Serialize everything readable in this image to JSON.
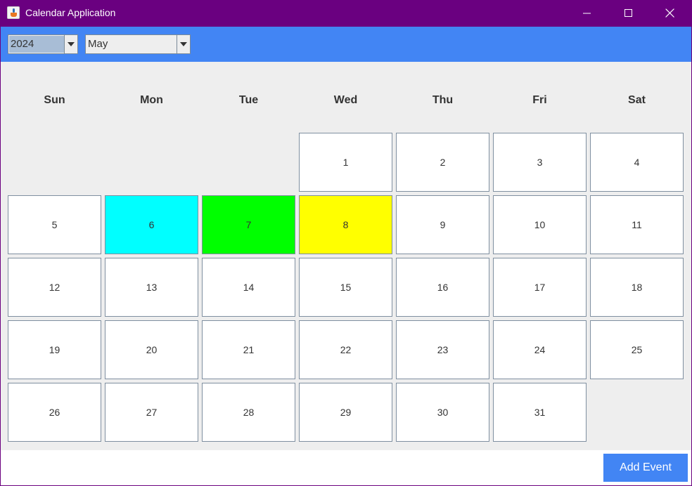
{
  "window": {
    "title": "Calendar Application",
    "icon": "java-cup-icon"
  },
  "toolbar": {
    "year": {
      "selected": "2024"
    },
    "month": {
      "selected": "May"
    }
  },
  "calendar": {
    "weekdays": [
      "Sun",
      "Mon",
      "Tue",
      "Wed",
      "Thu",
      "Fri",
      "Sat"
    ],
    "first_weekday_index": 3,
    "days": [
      "1",
      "2",
      "3",
      "4",
      "5",
      "6",
      "7",
      "8",
      "9",
      "10",
      "11",
      "12",
      "13",
      "14",
      "15",
      "16",
      "17",
      "18",
      "19",
      "20",
      "21",
      "22",
      "23",
      "24",
      "25",
      "26",
      "27",
      "28",
      "29",
      "30",
      "31"
    ],
    "highlights": {
      "6": "#00ffff",
      "7": "#00ff00",
      "8": "#ffff00"
    }
  },
  "footer": {
    "add_event_label": "Add Event"
  },
  "colors": {
    "titlebar": "#6a0080",
    "toolbar": "#4285f4",
    "button": "#4285f4"
  }
}
